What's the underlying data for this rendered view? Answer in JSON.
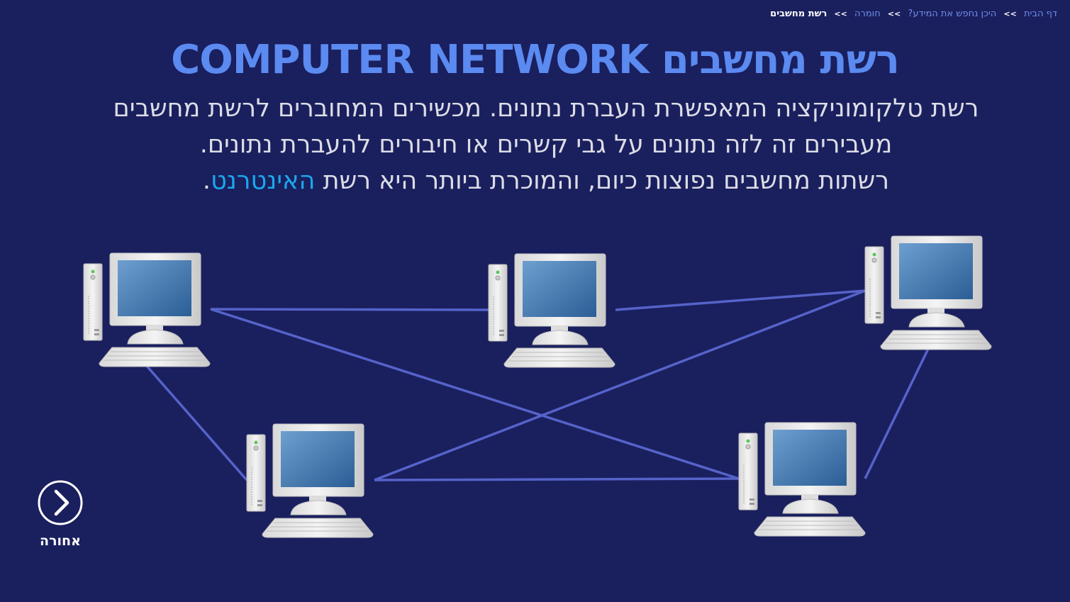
{
  "breadcrumb": {
    "items": [
      "דף הבית",
      "היכן נחפש את המידע?",
      "חומרה"
    ],
    "current": "רשת מחשבים",
    "separator": "<<"
  },
  "title": "רשת מחשבים COMPUTER NETWORK",
  "body": {
    "line1": "רשת טלקומוניקציה המאפשרת העברת נתונים. מכשירים המחוברים לרשת מחשבים",
    "line2": "מעבירים זה לזה נתונים על גבי קשרים או חיבורים להעברת נתונים.",
    "line3_prefix": "רשתות מחשבים נפוצות כיום, והמוכרת ביותר היא רשת ",
    "line3_link": "האינטרנט",
    "line3_suffix": "."
  },
  "back_button": {
    "label": "אחורה",
    "icon": "chevron-right-icon"
  },
  "colors": {
    "background": "#1a1f5e",
    "title": "#5b8af0",
    "link": "#1ba7ec",
    "connection": "#5563c9"
  }
}
